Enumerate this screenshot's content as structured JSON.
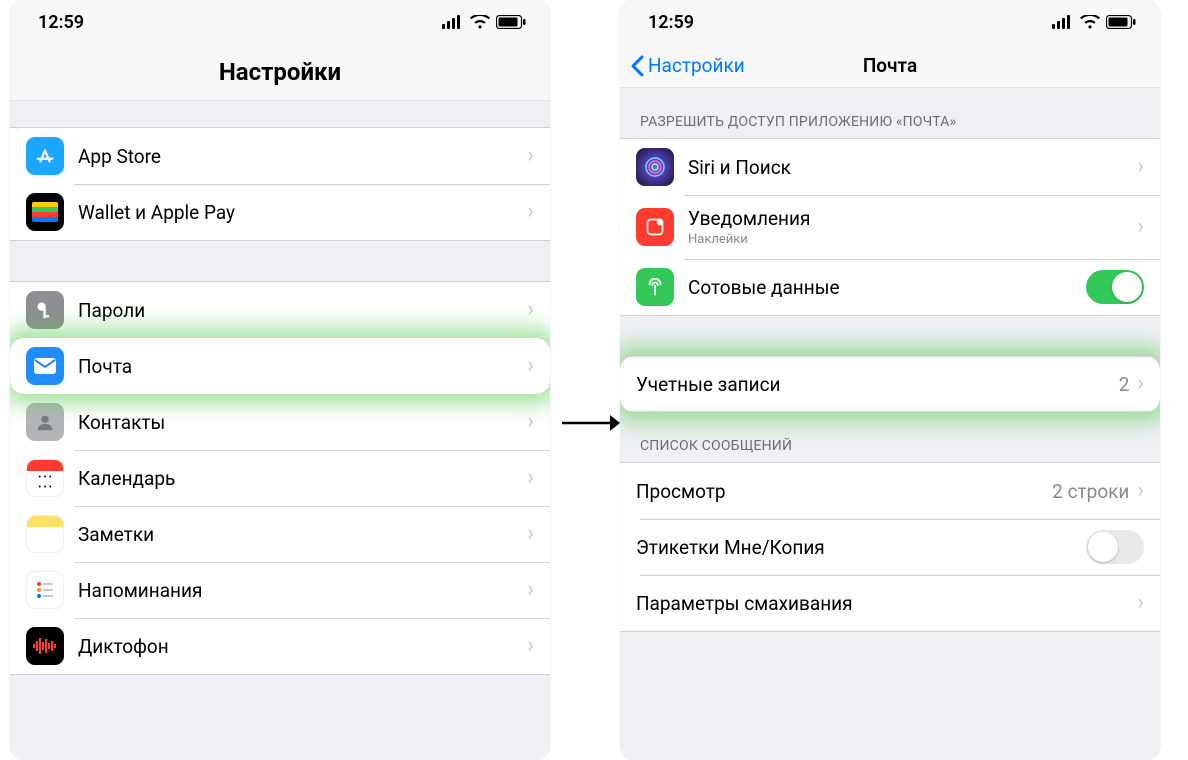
{
  "status": {
    "time": "12:59"
  },
  "left": {
    "title": "Настройки",
    "group1": [
      {
        "key": "appstore",
        "label": "App Store"
      },
      {
        "key": "wallet",
        "label": "Wallet и Apple Pay"
      }
    ],
    "group2": [
      {
        "key": "passwords",
        "label": "Пароли"
      },
      {
        "key": "mail",
        "label": "Почта",
        "highlight": true
      },
      {
        "key": "contacts",
        "label": "Контакты"
      },
      {
        "key": "calendar",
        "label": "Календарь"
      },
      {
        "key": "notes",
        "label": "Заметки"
      },
      {
        "key": "reminders",
        "label": "Напоминания"
      },
      {
        "key": "voicememo",
        "label": "Диктофон"
      }
    ]
  },
  "right": {
    "back": "Настройки",
    "title": "Почта",
    "section_access": "РАЗРЕШИТЬ ДОСТУП ПРИЛОЖЕНИЮ «ПОЧТА»",
    "access": {
      "siri": {
        "label": "Siri и Поиск"
      },
      "notif": {
        "label": "Уведомления",
        "sub": "Наклейки"
      },
      "cell": {
        "label": "Сотовые данные",
        "toggle": true
      }
    },
    "accounts": {
      "label": "Учетные записи",
      "count": "2"
    },
    "section_list": "СПИСОК СООБЩЕНИЙ",
    "list": {
      "preview": {
        "label": "Просмотр",
        "detail": "2 строки"
      },
      "labels": {
        "label": "Этикетки Мне/Копия",
        "toggle": false
      },
      "swipe": {
        "label": "Параметры смахивания"
      }
    }
  }
}
